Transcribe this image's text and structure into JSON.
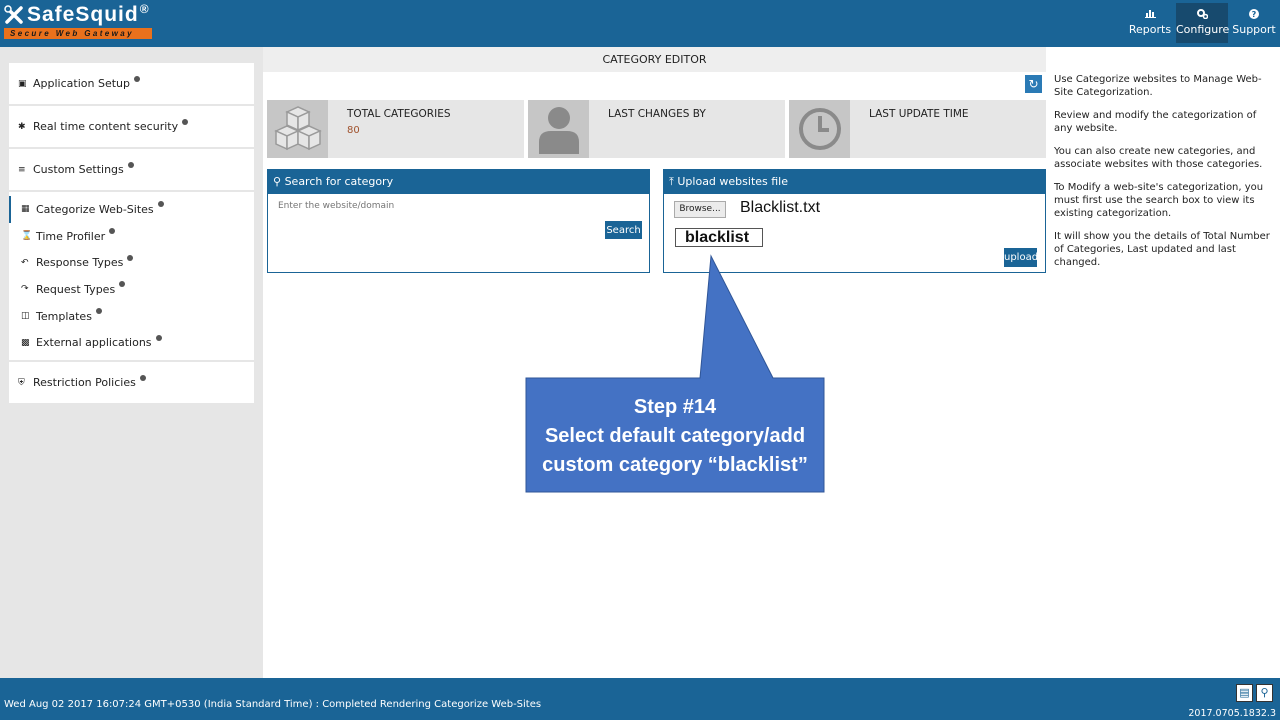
{
  "header": {
    "brand": "SafeSquid",
    "brand_mark": "®",
    "tagline": "Secure Web Gateway",
    "nav": [
      {
        "label": "Reports",
        "icon": "bar-chart-icon"
      },
      {
        "label": "Configure",
        "icon": "gears-icon"
      },
      {
        "label": "Support",
        "icon": "question-icon"
      }
    ]
  },
  "sidebar": {
    "sections": [
      {
        "label": "Application Setup",
        "icon": "briefcase-icon"
      },
      {
        "label": "Real time content security",
        "icon": "bug-icon"
      },
      {
        "label": "Custom Settings",
        "icon": "sliders-icon"
      }
    ],
    "custom_items": [
      {
        "label": "Categorize Web-Sites",
        "icon": "database-icon"
      },
      {
        "label": "Time Profiler",
        "icon": "hourglass-icon"
      },
      {
        "label": "Response Types",
        "icon": "reply-icon"
      },
      {
        "label": "Request Types",
        "icon": "share-icon"
      },
      {
        "label": "Templates",
        "icon": "templates-icon"
      },
      {
        "label": "External applications",
        "icon": "external-icon"
      }
    ],
    "restriction": {
      "label": "Restriction Policies",
      "icon": "shield-icon"
    }
  },
  "main": {
    "title": "CATEGORY EDITOR",
    "stats": [
      {
        "label": "TOTAL CATEGORIES",
        "value": "80",
        "icon": "cubes-icon"
      },
      {
        "label": "LAST CHANGES BY",
        "value": "",
        "icon": "user-icon"
      },
      {
        "label": "LAST UPDATE TIME",
        "value": "",
        "icon": "clock-icon"
      }
    ],
    "search_panel": {
      "title": "Search for category",
      "placeholder": "Enter the website/domain",
      "button": "Search"
    },
    "upload_panel": {
      "title": "Upload websites file",
      "browse": "Browse...",
      "filename": "Blacklist.txt",
      "category": "blacklist",
      "button": "upload"
    }
  },
  "callout": {
    "line1": "Step #14",
    "line2": "Select default category/add",
    "line3": "custom category “blacklist”"
  },
  "help": [
    "Use Categorize websites to Manage Web-Site Categorization.",
    "Review and modify the categorization of any website.",
    "You can also create new categories, and associate websites with those categories.",
    "To Modify a web-site's categorization, you must first use the search box to view its existing categorization.",
    "It will show you the details of Total Number of Categories, Last updated and last changed."
  ],
  "footer": {
    "status": "Wed Aug 02 2017 16:07:24 GMT+0530 (India Standard Time) : Completed Rendering Categorize Web-Sites",
    "version": "2017.0705.1832.3"
  }
}
